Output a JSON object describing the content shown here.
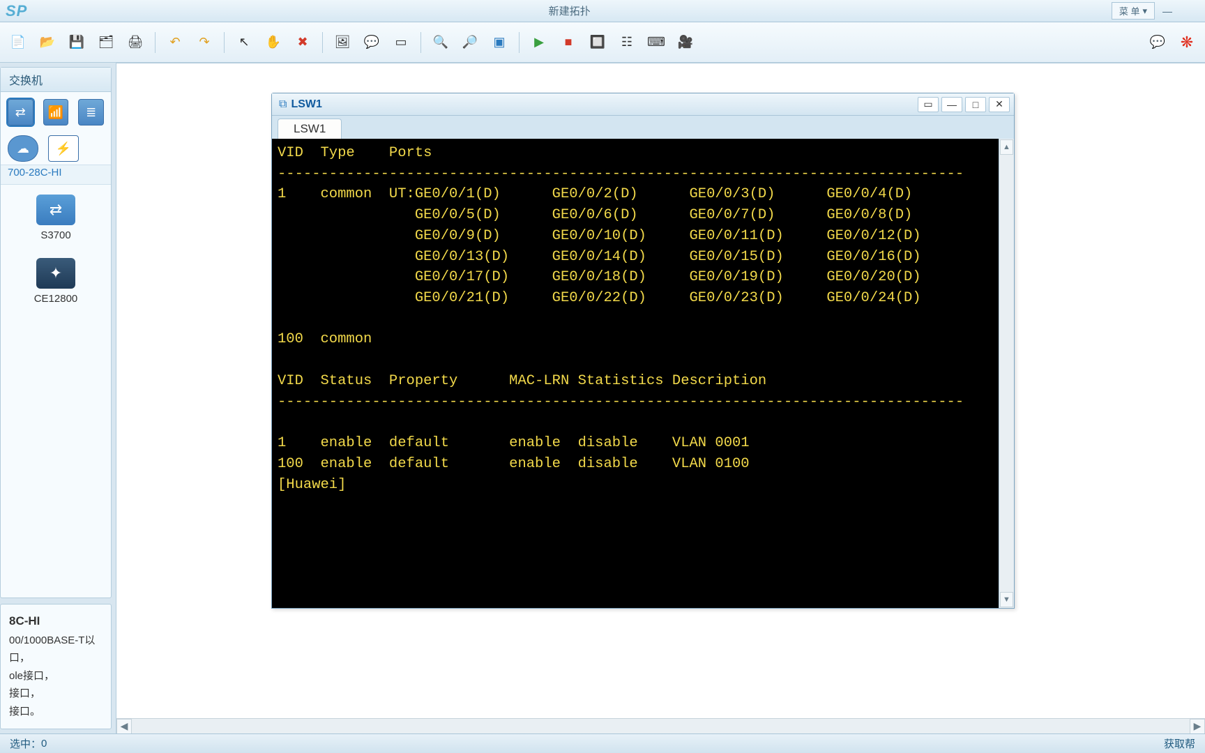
{
  "app": {
    "logo": "SP",
    "title": "新建拓扑"
  },
  "titlebar": {
    "menu_label": "菜 单"
  },
  "sidebar": {
    "header": "交换机",
    "subheader": "700-28C-HI",
    "devices": [
      {
        "label": "S3700"
      },
      {
        "label": "CE12800"
      }
    ]
  },
  "info": {
    "header": "8C-HI",
    "lines": [
      "00/1000BASE-T以",
      "口，",
      "ole接口，",
      "接口，",
      "接口。"
    ]
  },
  "terminal": {
    "title": "LSW1",
    "tab": "LSW1",
    "lines": [
      "VID  Type    Ports",
      "--------------------------------------------------------------------------------",
      "1    common  UT:GE0/0/1(D)      GE0/0/2(D)      GE0/0/3(D)      GE0/0/4(D)",
      "                GE0/0/5(D)      GE0/0/6(D)      GE0/0/7(D)      GE0/0/8(D)",
      "                GE0/0/9(D)      GE0/0/10(D)     GE0/0/11(D)     GE0/0/12(D)",
      "                GE0/0/13(D)     GE0/0/14(D)     GE0/0/15(D)     GE0/0/16(D)",
      "                GE0/0/17(D)     GE0/0/18(D)     GE0/0/19(D)     GE0/0/20(D)",
      "                GE0/0/21(D)     GE0/0/22(D)     GE0/0/23(D)     GE0/0/24(D)",
      "",
      "100  common",
      "",
      "VID  Status  Property      MAC-LRN Statistics Description",
      "--------------------------------------------------------------------------------",
      "",
      "1    enable  default       enable  disable    VLAN 0001",
      "100  enable  default       enable  disable    VLAN 0100",
      "[Huawei]"
    ]
  },
  "status": {
    "left_label": "选中：",
    "count": "0",
    "right": "获取帮"
  },
  "icons": {
    "minimize": "—",
    "close": "✕",
    "maximize": "□",
    "restore": "❐",
    "dropdown": "▾"
  }
}
